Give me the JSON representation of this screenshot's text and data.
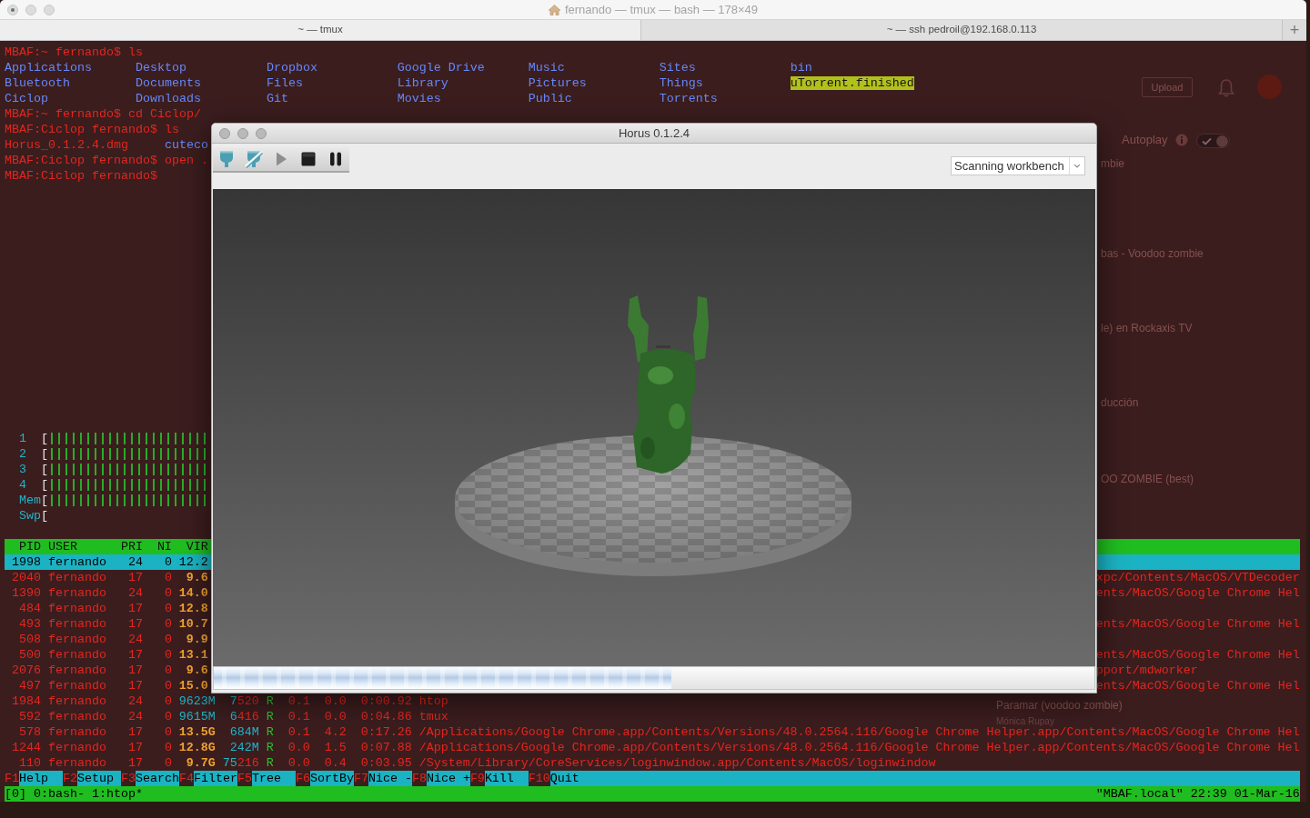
{
  "terminal_window": {
    "title": "fernando — tmux — bash — 178×49",
    "tabs": [
      {
        "label": "~ — tmux",
        "selected": true
      },
      {
        "label": "~ — ssh pedroil@192.168.0.113",
        "selected": false
      }
    ],
    "new_tab_button": "+"
  },
  "shell": [
    {
      "kind": "command",
      "text": "MBAF:~ fernando$ ls"
    },
    {
      "kind": "listing",
      "entries": [
        {
          "name": "Applications",
          "kind": "dir"
        },
        {
          "name": "Desktop",
          "kind": "dir"
        },
        {
          "name": "Dropbox",
          "kind": "dir"
        },
        {
          "name": "Google Drive",
          "kind": "dir"
        },
        {
          "name": "Music",
          "kind": "dir"
        },
        {
          "name": "Sites",
          "kind": "dir"
        },
        {
          "name": "bin",
          "kind": "dir"
        }
      ]
    },
    {
      "kind": "listing",
      "entries": [
        {
          "name": "Bluetooth",
          "kind": "dir"
        },
        {
          "name": "Documents",
          "kind": "dir"
        },
        {
          "name": "Files",
          "kind": "dir"
        },
        {
          "name": "Library",
          "kind": "dir"
        },
        {
          "name": "Pictures",
          "kind": "dir"
        },
        {
          "name": "Things",
          "kind": "dir"
        },
        {
          "name": "uTorrent.finished",
          "kind": "writable_dir"
        }
      ]
    },
    {
      "kind": "listing",
      "entries": [
        {
          "name": "Ciclop",
          "kind": "dir"
        },
        {
          "name": "Downloads",
          "kind": "dir"
        },
        {
          "name": "Git",
          "kind": "dir"
        },
        {
          "name": "Movies",
          "kind": "dir"
        },
        {
          "name": "Public",
          "kind": "dir"
        },
        {
          "name": "Torrents",
          "kind": "dir"
        }
      ]
    },
    {
      "kind": "command",
      "text": "MBAF:~ fernando$ cd Ciclop/"
    },
    {
      "kind": "command",
      "text": "MBAF:Ciclop fernando$ ls"
    },
    {
      "kind": "listing",
      "entries": [
        {
          "name": "Horus_0.1.2.4.dmg",
          "kind": "file"
        },
        {
          "name": "cuteco",
          "kind": "dir"
        }
      ]
    },
    {
      "kind": "command",
      "text": "MBAF:Ciclop fernando$ open ."
    },
    {
      "kind": "command",
      "text": "MBAF:Ciclop fernando$"
    }
  ],
  "htop": {
    "meters": [
      {
        "label": "1",
        "bracket": "[",
        "used": true
      },
      {
        "label": "2",
        "bracket": "[",
        "used": true
      },
      {
        "label": "3",
        "bracket": "[",
        "used": true
      },
      {
        "label": "4",
        "bracket": "[",
        "used": true
      },
      {
        "label": "Mem",
        "bracket": "[",
        "used": true
      },
      {
        "label": "Swp",
        "bracket": "[",
        "used": false
      }
    ],
    "columns": [
      "PID",
      "USER",
      "PRI",
      "NI",
      "VIR"
    ],
    "processes": [
      {
        "selected": true,
        "pid": "1998",
        "user": "fernando",
        "pri": "24",
        "ni": "0",
        "virt": [
          {
            "text": "12.2",
            "kind": "giga"
          }
        ]
      },
      {
        "selected": false,
        "pid": "2040",
        "user": "fernando",
        "pri": "17",
        "ni": "0",
        "virt": [
          {
            "text": "9.6",
            "kind": "giga"
          }
        ],
        "command": "xpc/Contents/MacOS/VTDecoder"
      },
      {
        "selected": false,
        "pid": "1390",
        "user": "fernando",
        "pri": "24",
        "ni": "0",
        "virt": [
          {
            "text": "14.0",
            "kind": "giga"
          }
        ],
        "command": "ents/MacOS/Google Chrome Hel"
      },
      {
        "selected": false,
        "pid": "484",
        "user": "fernando",
        "pri": "17",
        "ni": "0",
        "virt": [
          {
            "text": "12.8",
            "kind": "giga"
          }
        ]
      },
      {
        "selected": false,
        "pid": "493",
        "user": "fernando",
        "pri": "17",
        "ni": "0",
        "virt": [
          {
            "text": "10.7",
            "kind": "giga"
          }
        ],
        "command": "ents/MacOS/Google Chrome Hel"
      },
      {
        "selected": false,
        "pid": "508",
        "user": "fernando",
        "pri": "24",
        "ni": "0",
        "virt": [
          {
            "text": "9.9",
            "kind": "giga"
          }
        ]
      },
      {
        "selected": false,
        "pid": "500",
        "user": "fernando",
        "pri": "17",
        "ni": "0",
        "virt": [
          {
            "text": "13.1",
            "kind": "giga"
          }
        ],
        "command": "ents/MacOS/Google Chrome Hel"
      },
      {
        "selected": false,
        "pid": "2076",
        "user": "fernando",
        "pri": "17",
        "ni": "0",
        "virt": [
          {
            "text": "9.6",
            "kind": "giga"
          }
        ],
        "command": "pport/mdworker"
      },
      {
        "selected": false,
        "pid": "497",
        "user": "fernando",
        "pri": "17",
        "ni": "0",
        "virt": [
          {
            "text": "15.0",
            "kind": "giga"
          }
        ],
        "command": "ents/MacOS/Google Chrome Hel"
      },
      {
        "selected": false,
        "pid": "1984",
        "user": "fernando",
        "pri": "24",
        "ni": "0",
        "virt": [
          {
            "text": "9623M",
            "kind": "mega"
          }
        ],
        "res": [
          {
            "text": "7",
            "kind": "mega"
          },
          {
            "text": "520",
            "kind": "base"
          }
        ],
        "state": "R",
        "cpu": "0.1",
        "mem": "0.0",
        "time": "0:00.92",
        "command": "htop"
      },
      {
        "selected": false,
        "pid": "592",
        "user": "fernando",
        "pri": "24",
        "ni": "0",
        "virt": [
          {
            "text": "9615M",
            "kind": "mega"
          }
        ],
        "res": [
          {
            "text": "6",
            "kind": "mega"
          },
          {
            "text": "416",
            "kind": "base"
          }
        ],
        "state": "R",
        "cpu": "0.1",
        "mem": "0.0",
        "time": "0:04.86",
        "command": "tmux"
      },
      {
        "selected": false,
        "pid": "578",
        "user": "fernando",
        "pri": "17",
        "ni": "0",
        "virt": [
          {
            "text": "13.5G",
            "kind": "giga"
          }
        ],
        "res": [
          {
            "text": "684M",
            "kind": "mega"
          }
        ],
        "state": "R",
        "cpu": "0.1",
        "mem": "4.2",
        "time": "0:17.26",
        "command": "/Applications/Google Chrome.app/Contents/Versions/48.0.2564.116/Google Chrome Helper.app/Contents/MacOS/Google Chrome Hel"
      },
      {
        "selected": false,
        "pid": "1244",
        "user": "fernando",
        "pri": "17",
        "ni": "0",
        "virt": [
          {
            "text": "12.8G",
            "kind": "giga"
          }
        ],
        "res": [
          {
            "text": "242M",
            "kind": "mega"
          }
        ],
        "state": "R",
        "cpu": "0.0",
        "mem": "1.5",
        "time": "0:07.88",
        "command": "/Applications/Google Chrome.app/Contents/Versions/48.0.2564.116/Google Chrome Helper.app/Contents/MacOS/Google Chrome Hel"
      },
      {
        "selected": false,
        "pid": "110",
        "user": "fernando",
        "pri": "17",
        "ni": "0",
        "virt": [
          {
            "text": "9.7G",
            "kind": "giga"
          }
        ],
        "res": [
          {
            "text": "75",
            "kind": "mega"
          },
          {
            "text": "216",
            "kind": "base"
          }
        ],
        "state": "R",
        "cpu": "0.0",
        "mem": "0.4",
        "time": "0:03.95",
        "command": "/System/Library/CoreServices/loginwindow.app/Contents/MacOS/loginwindow"
      }
    ],
    "function_keys": [
      {
        "key": "F1",
        "label": "Help"
      },
      {
        "key": "F2",
        "label": "Setup"
      },
      {
        "key": "F3",
        "label": "Search"
      },
      {
        "key": "F4",
        "label": "Filter"
      },
      {
        "key": "F5",
        "label": "Tree"
      },
      {
        "key": "F6",
        "label": "SortBy"
      },
      {
        "key": "F7",
        "label": "Nice -"
      },
      {
        "key": "F8",
        "label": "Nice +"
      },
      {
        "key": "F9",
        "label": "Kill"
      },
      {
        "key": "F10",
        "label": "Quit"
      }
    ]
  },
  "tmux_status": {
    "session": "[0]",
    "windows": [
      "0:bash-",
      "1:htop*"
    ],
    "right": "\"MBAF.local\" 22:39 01-Mar-16"
  },
  "horus_window": {
    "title": "Horus 0.1.2.4",
    "tools": [
      {
        "kind": "connect",
        "disabled": false
      },
      {
        "kind": "disconnect",
        "disabled": false
      },
      {
        "kind": "play",
        "disabled": true
      },
      {
        "kind": "stop",
        "disabled": false
      },
      {
        "kind": "pause",
        "disabled": false
      }
    ],
    "workbench": {
      "value": "Scanning workbench"
    },
    "progress": {
      "level": 0.52
    }
  },
  "browser_behind": {
    "upload_button": "Upload",
    "autoplay": {
      "label": "Autoplay",
      "on": true
    },
    "video_titles": [
      "mbie",
      "bas - Voodoo zombie",
      "le) en Rockaxis TV",
      "ducción",
      "OO ZOMBIE (best)"
    ],
    "related_video": {
      "title": "Paramar (voodoo zombie)",
      "channel": "Mónica Rupay"
    }
  }
}
